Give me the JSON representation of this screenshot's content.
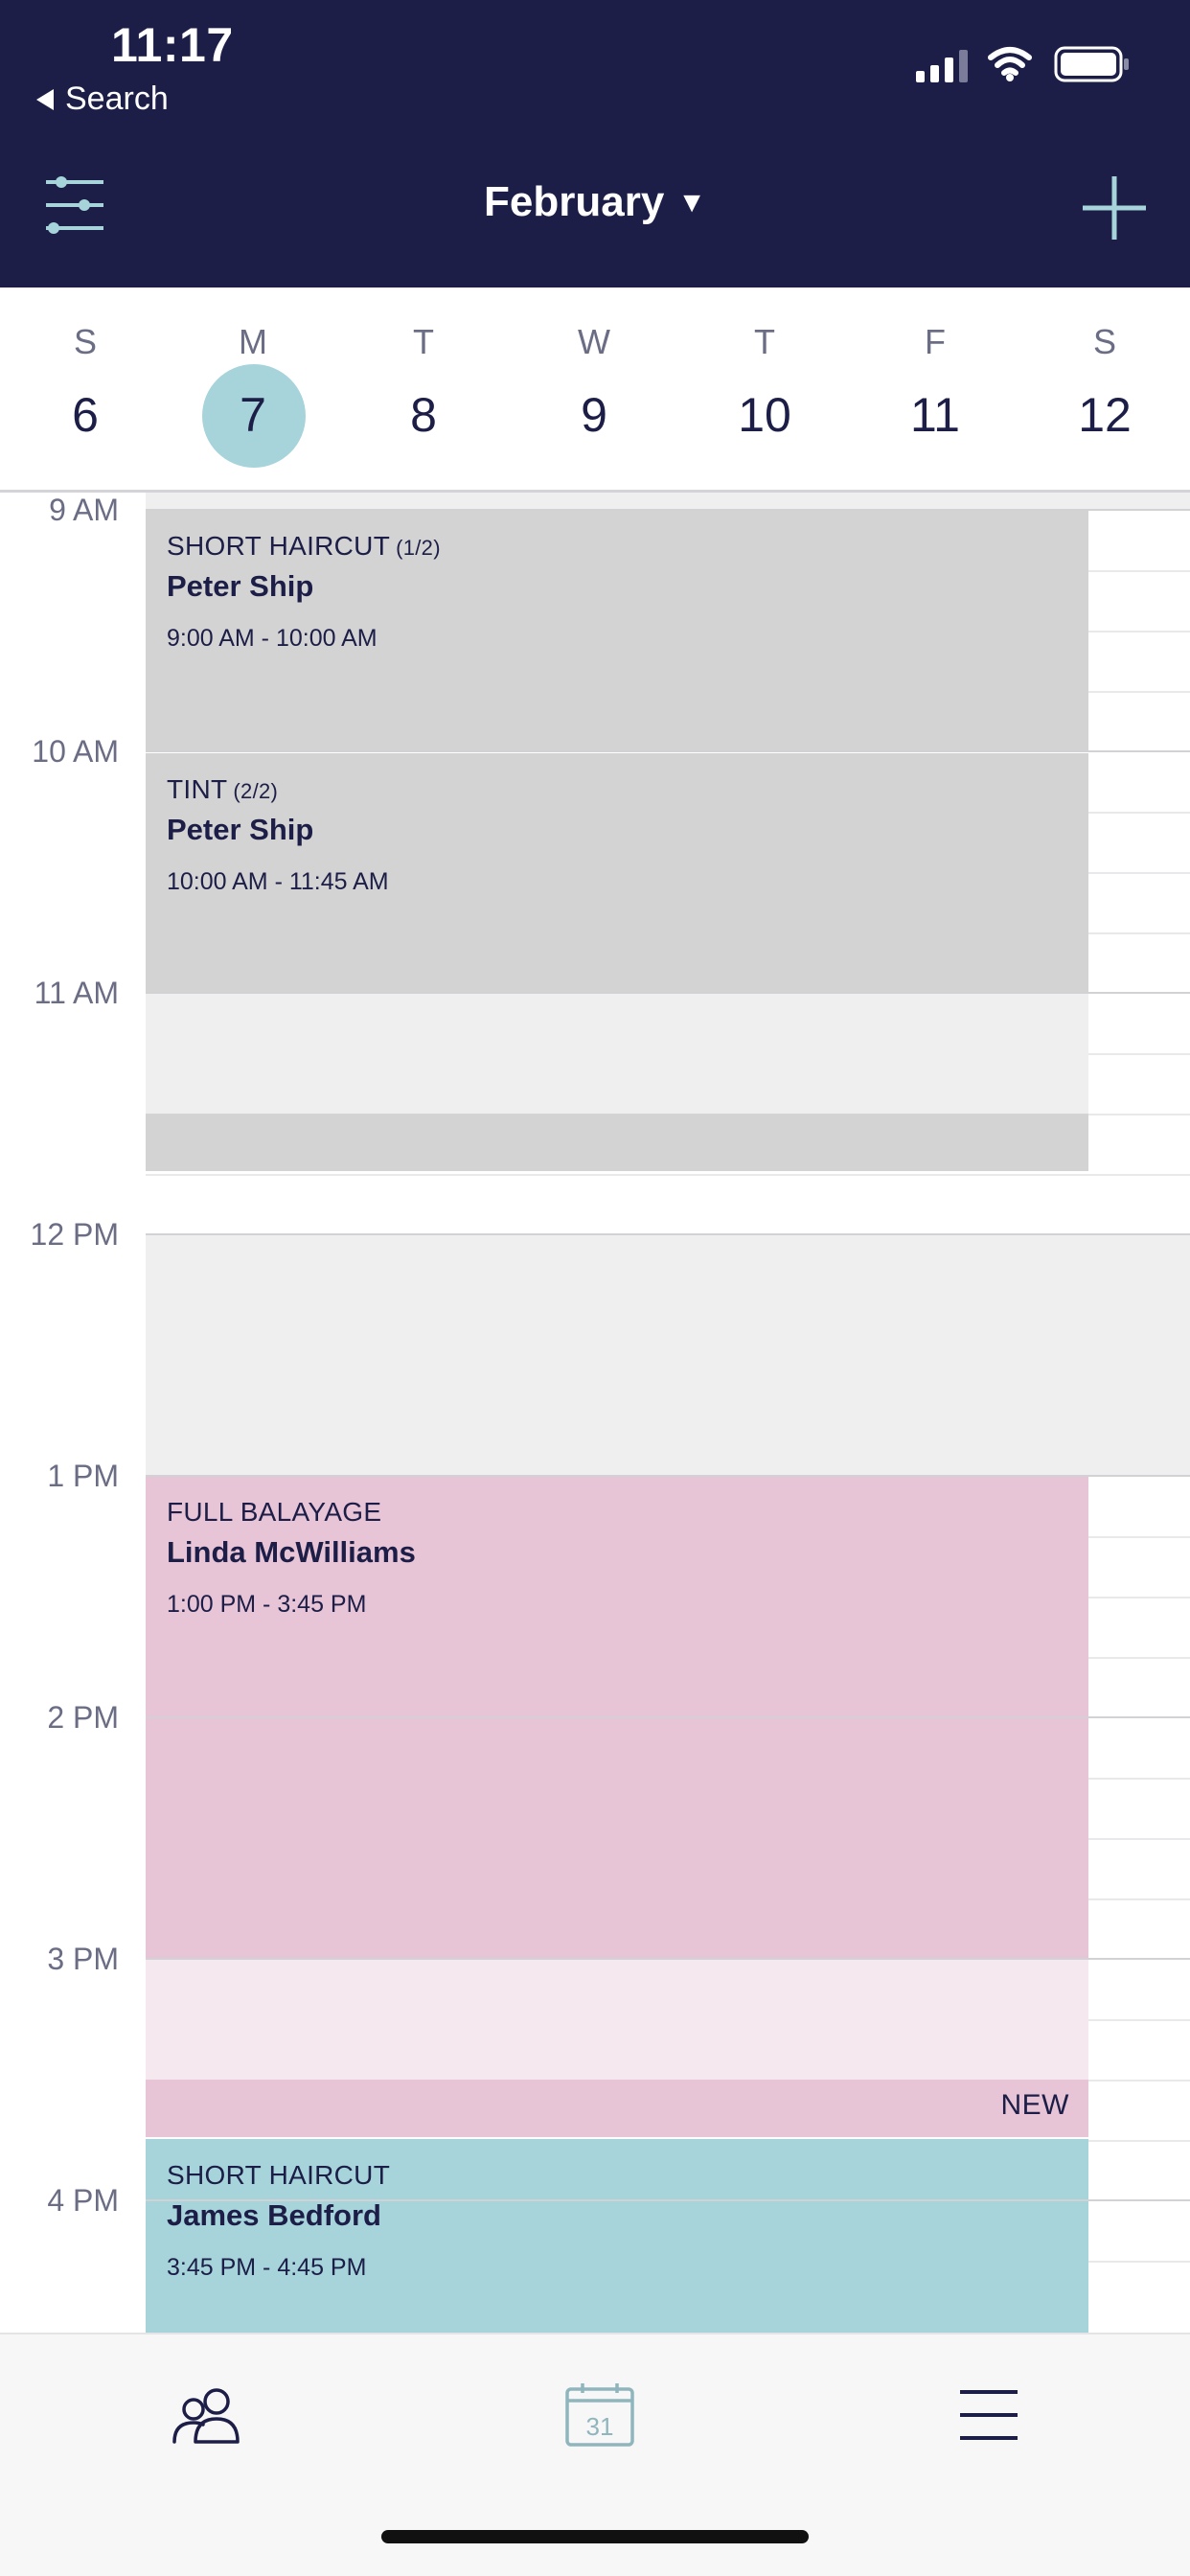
{
  "status_bar": {
    "time": "11:17",
    "back_label": "Search",
    "signal_icon": "cellular-signal-icon",
    "wifi_icon": "wifi-icon",
    "battery_icon": "battery-icon"
  },
  "header": {
    "month": "February",
    "caret": "▼",
    "filter_icon": "sliders-icon",
    "add_icon": "plus-icon"
  },
  "week": {
    "selected_index": 1,
    "days": [
      {
        "name": "S",
        "num": "6"
      },
      {
        "name": "M",
        "num": "7"
      },
      {
        "name": "T",
        "num": "8"
      },
      {
        "name": "W",
        "num": "9"
      },
      {
        "name": "T",
        "num": "10"
      },
      {
        "name": "F",
        "num": "11"
      },
      {
        "name": "S",
        "num": "12"
      }
    ]
  },
  "hours": [
    "9 AM",
    "10 AM",
    "11 AM",
    "12 PM",
    "1 PM",
    "2 PM",
    "3 PM",
    "4 PM"
  ],
  "appointments": [
    {
      "service": "SHORT HAIRCUT",
      "part": "(1/2)",
      "client": "Peter Ship",
      "time": "9:00 AM - 10:00 AM"
    },
    {
      "service": "TINT",
      "part": "(2/2)",
      "client": "Peter Ship",
      "time": "10:00 AM - 11:45 AM"
    },
    {
      "service": "FULL BALAYAGE",
      "part": "",
      "client": "Linda McWilliams",
      "time": "1:00 PM - 3:45 PM",
      "badge": "NEW"
    },
    {
      "service": "SHORT HAIRCUT",
      "part": "",
      "client": "James Bedford",
      "time": "3:45 PM - 4:45 PM"
    }
  ],
  "colors": {
    "header_bg": "#1c1e47",
    "accent_teal": "#a6d4da",
    "appt_grey": "#d3d3d3",
    "appt_pink": "#e7c4d6",
    "blocked": "#efefef"
  },
  "tabbar": {
    "clients_icon": "clients-icon",
    "calendar_icon": "calendar-icon",
    "calendar_day": "31",
    "menu_icon": "menu-icon"
  }
}
